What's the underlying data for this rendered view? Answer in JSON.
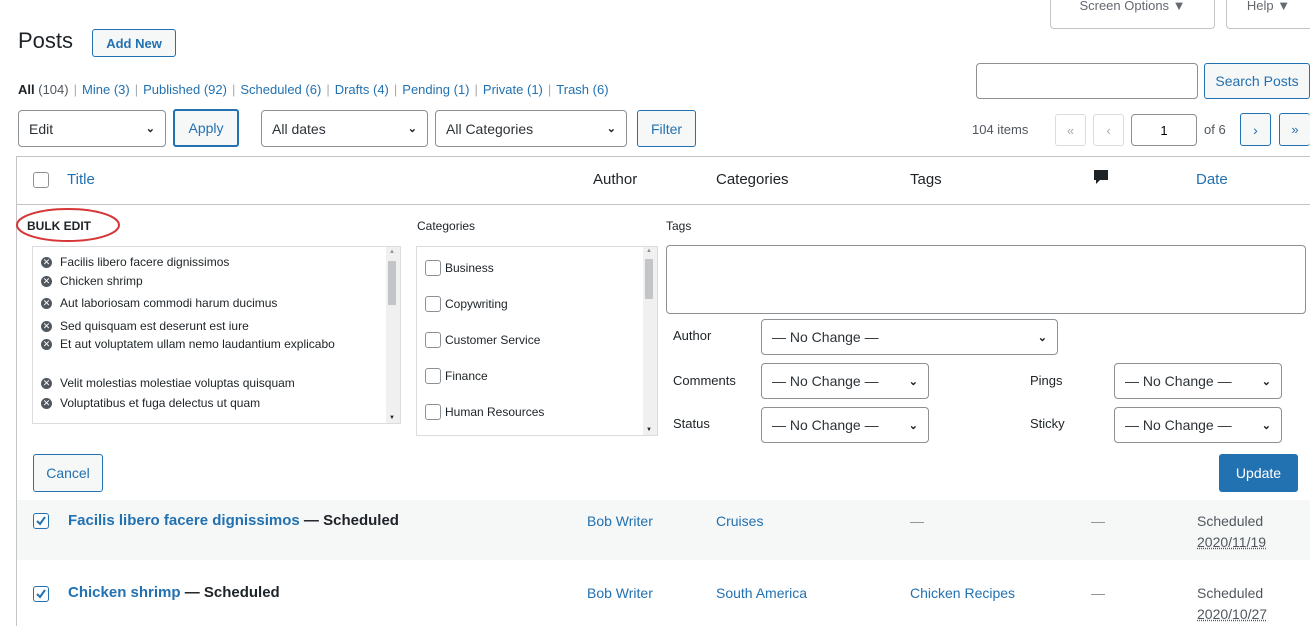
{
  "header": {
    "title": "Posts",
    "add_new": "Add New",
    "screen_options": "Screen Options ▼",
    "help": "Help ▼"
  },
  "filters": [
    {
      "label": "All",
      "count": "(104)",
      "current": true
    },
    {
      "label": "Mine",
      "count": "(3)"
    },
    {
      "label": "Published",
      "count": "(92)"
    },
    {
      "label": "Scheduled",
      "count": "(6)"
    },
    {
      "label": "Drafts",
      "count": "(4)"
    },
    {
      "label": "Pending",
      "count": "(1)"
    },
    {
      "label": "Private",
      "count": "(1)"
    },
    {
      "label": "Trash",
      "count": "(6)"
    }
  ],
  "search": {
    "value": "",
    "button": "Search Posts"
  },
  "toolbar": {
    "bulk_action": "Edit",
    "apply": "Apply",
    "dates": "All dates",
    "categories": "All Categories",
    "filter": "Filter",
    "items": "104 items",
    "first": "«",
    "prev": "‹",
    "page": "1",
    "of": "of 6",
    "next": "›",
    "last": "»"
  },
  "columns": {
    "title": "Title",
    "author": "Author",
    "categories": "Categories",
    "tags": "Tags",
    "date": "Date"
  },
  "bulk_edit": {
    "heading": "BULK EDIT",
    "categories_label": "Categories",
    "tags_label": "Tags",
    "posts": [
      "Facilis libero facere dignissimos",
      "Chicken shrimp",
      "Aut laboriosam commodi harum ducimus",
      "Sed quisquam est deserunt est iure",
      "Et aut voluptatem ullam nemo laudantium explicabo",
      "Velit molestias molestiae voluptas quisquam",
      "Voluptatibus et fuga delectus ut quam"
    ],
    "category_options": [
      "Business",
      "Copywriting",
      "Customer Service",
      "Finance",
      "Human Resources"
    ],
    "author_label": "Author",
    "author_value": "— No Change —",
    "comments_label": "Comments",
    "comments_value": "— No Change —",
    "pings_label": "Pings",
    "pings_value": "— No Change —",
    "status_label": "Status",
    "status_value": "— No Change —",
    "sticky_label": "Sticky",
    "sticky_value": "— No Change —",
    "cancel": "Cancel",
    "update": "Update"
  },
  "rows": [
    {
      "title": "Facilis libero facere dignissimos",
      "state": " — Scheduled",
      "author": "Bob Writer",
      "categories": "Cruises",
      "tags": "—",
      "comments": "—",
      "date_status": "Scheduled",
      "date": "2020/11/19"
    },
    {
      "title": "Chicken shrimp",
      "state": " — Scheduled",
      "author": "Bob Writer",
      "categories": "South America",
      "tags": "Chicken Recipes",
      "comments": "—",
      "date_status": "Scheduled",
      "date": "2020/10/27"
    }
  ],
  "colors": {
    "link": "#2271b1",
    "primary_button": "#2271b1",
    "highlight_circle": "#d63638",
    "row_alt": "#f6f7f7"
  }
}
